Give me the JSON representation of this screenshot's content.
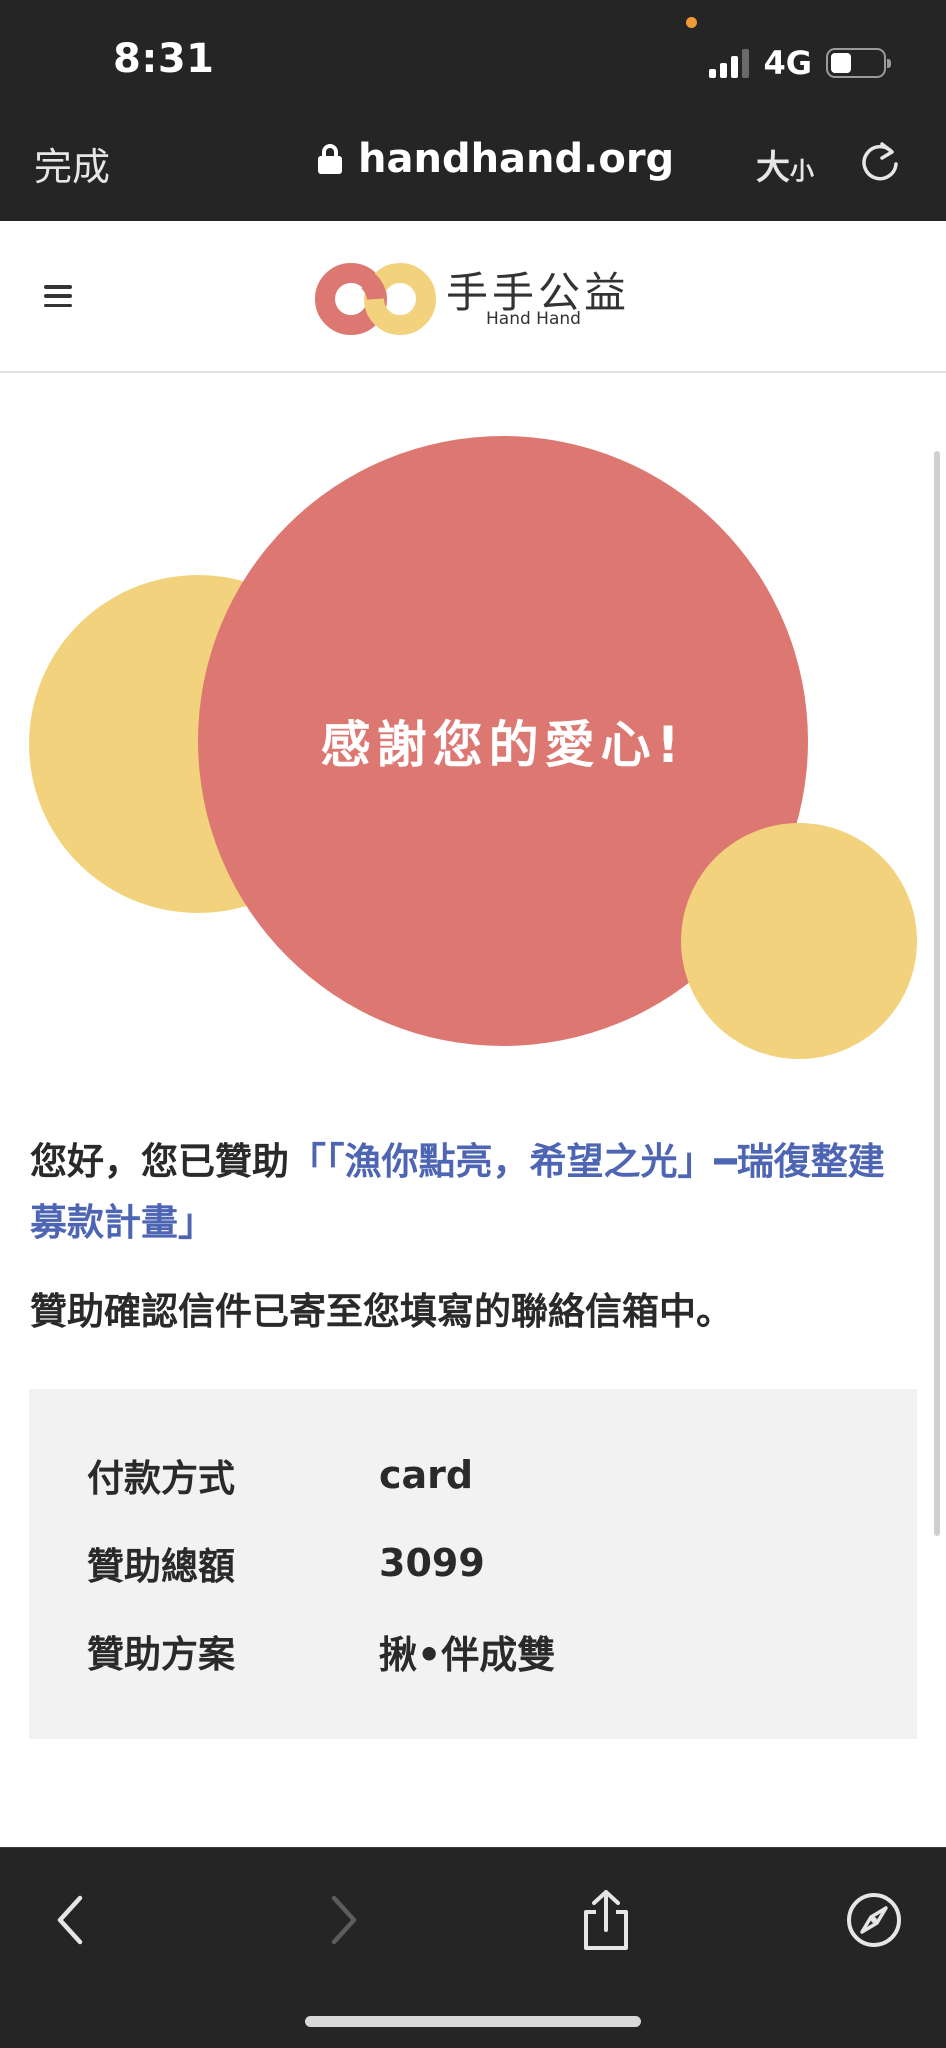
{
  "status_bar": {
    "time": "8:31",
    "network": "4G",
    "battery_level": 0.4
  },
  "browser": {
    "done_label": "完成",
    "url": "handhand.org",
    "textsize_big": "大",
    "textsize_small": "小"
  },
  "site": {
    "logo_title": "手手公益",
    "logo_sub": "Hand Hand"
  },
  "hero": {
    "thanks": "感謝您的愛心!"
  },
  "message": {
    "prefix": "您好，您已贊助",
    "project": "「「漁你點亮，希望之光」━瑞復整建募款計畫」",
    "confirm": "贊助確認信件已寄至您填寫的聯絡信箱中。"
  },
  "details": [
    {
      "label": "付款方式",
      "value": "card"
    },
    {
      "label": "贊助總額",
      "value": "3099"
    },
    {
      "label": "贊助方案",
      "value": "揪•伴成雙"
    }
  ],
  "colors": {
    "chrome": "#252525",
    "primary_circle": "#dd7772",
    "secondary_circle": "#f2d27c",
    "link": "#4d65b3"
  },
  "toolbar_icons": [
    "back-icon",
    "forward-icon",
    "share-icon",
    "compass-icon"
  ]
}
